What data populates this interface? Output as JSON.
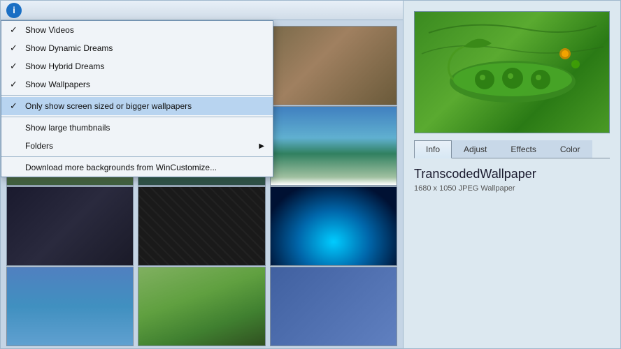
{
  "toolbar": {
    "info_icon_label": "i"
  },
  "menu": {
    "items": [
      {
        "id": "show-videos",
        "label": "Show Videos",
        "checked": true,
        "highlighted": false,
        "hasArrow": false
      },
      {
        "id": "show-dynamic-dreams",
        "label": "Show Dynamic Dreams",
        "checked": true,
        "highlighted": false,
        "hasArrow": false
      },
      {
        "id": "show-hybrid-dreams",
        "label": "Show Hybrid Dreams",
        "checked": true,
        "highlighted": false,
        "hasArrow": false
      },
      {
        "id": "show-wallpapers",
        "label": "Show Wallpapers",
        "checked": true,
        "highlighted": false,
        "hasArrow": false
      },
      {
        "id": "only-screen-sized",
        "label": "Only show screen sized or bigger wallpapers",
        "checked": true,
        "highlighted": true,
        "hasArrow": false
      },
      {
        "id": "show-large-thumbnails",
        "label": "Show large thumbnails",
        "checked": false,
        "highlighted": false,
        "hasArrow": false
      },
      {
        "id": "folders",
        "label": "Folders",
        "checked": false,
        "highlighted": false,
        "hasArrow": true
      },
      {
        "id": "download-more",
        "label": "Download more backgrounds from WinCustomize...",
        "checked": false,
        "highlighted": false,
        "hasArrow": false
      }
    ]
  },
  "preview": {
    "title": "TranscodedWallpaper",
    "meta": "1680 x 1050 JPEG Wallpaper"
  },
  "tabs": [
    {
      "id": "info",
      "label": "Info",
      "active": true
    },
    {
      "id": "adjust",
      "label": "Adjust",
      "active": false
    },
    {
      "id": "effects",
      "label": "Effects",
      "active": false
    },
    {
      "id": "color",
      "label": "Color",
      "active": false
    }
  ],
  "thumbnails": [
    {
      "id": "purple-flowers",
      "class": "thumb-purple"
    },
    {
      "id": "desert",
      "class": "thumb-desert"
    },
    {
      "id": "empty1",
      "class": "thumb-purple"
    },
    {
      "id": "mountains",
      "class": "thumb-mountains"
    },
    {
      "id": "waterfall",
      "class": "thumb-water"
    },
    {
      "id": "ocean-beach",
      "class": "thumb-ocean"
    },
    {
      "id": "dark-texture1",
      "class": "thumb-dark1"
    },
    {
      "id": "dark-texture2",
      "class": "thumb-dark2"
    },
    {
      "id": "neon-swirl",
      "class": "thumb-neon"
    },
    {
      "id": "nature-partial1",
      "class": "thumb-water2"
    },
    {
      "id": "nature-partial2",
      "class": "thumb-nature"
    },
    {
      "id": "nature-partial3",
      "class": "thumb-partial"
    }
  ]
}
